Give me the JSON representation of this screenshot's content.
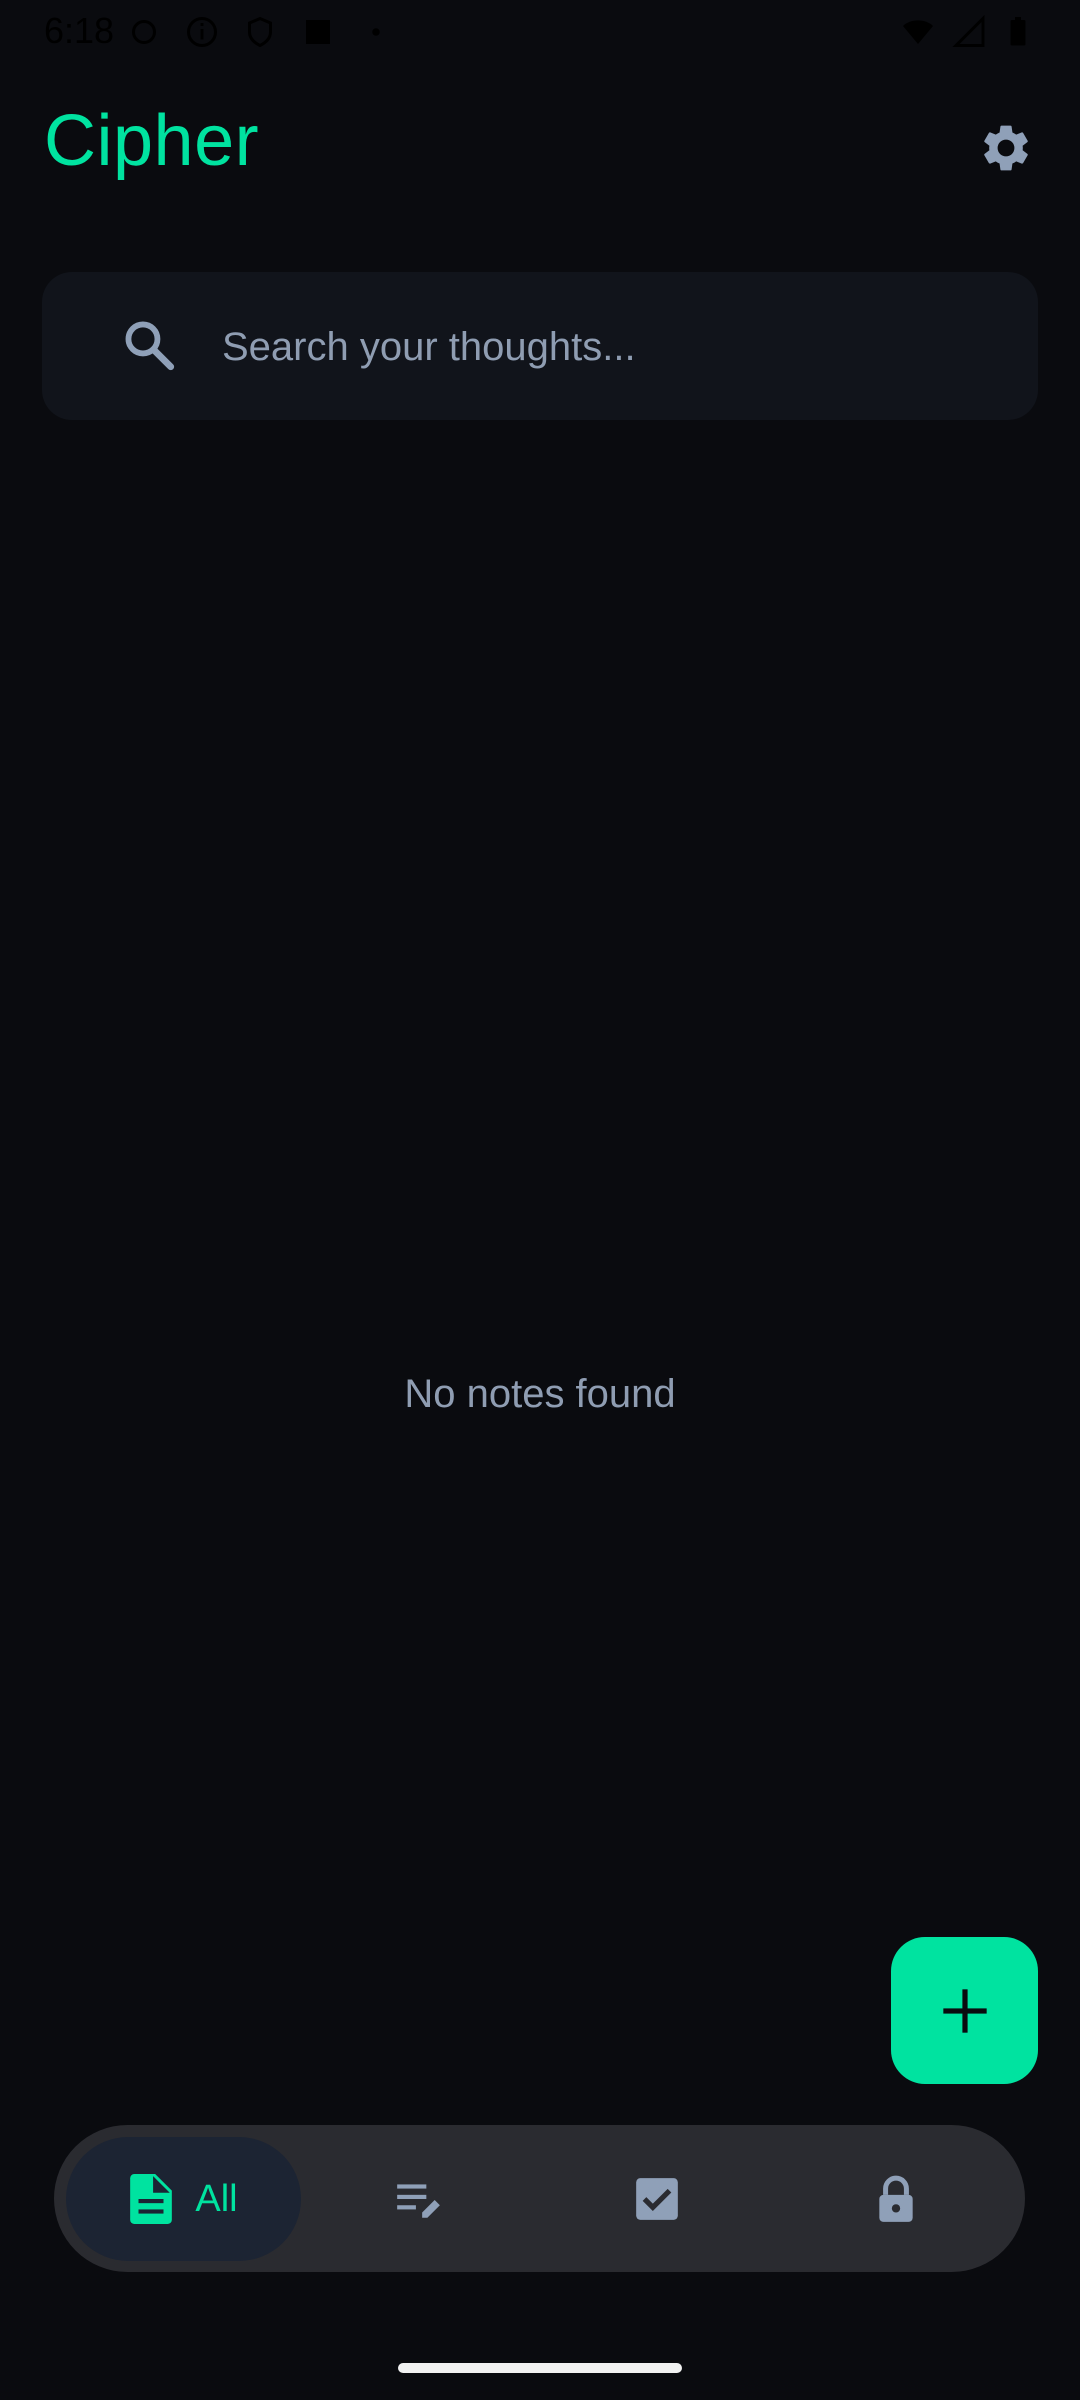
{
  "status_bar": {
    "time": "6:18"
  },
  "header": {
    "title": "Cipher"
  },
  "search": {
    "placeholder": "Search your thoughts..."
  },
  "main": {
    "empty_message": "No notes found"
  },
  "bottom_nav": {
    "items": [
      {
        "label": "All",
        "icon": "document-icon",
        "selected": true
      },
      {
        "label": "",
        "icon": "notes-edit-icon",
        "selected": false
      },
      {
        "label": "",
        "icon": "checkbox-icon",
        "selected": false
      },
      {
        "label": "",
        "icon": "lock-icon",
        "selected": false
      }
    ]
  },
  "colors": {
    "background": "#0a0b0f",
    "accent": "#00e3a0",
    "surface": "#11141b",
    "nav_background": "#2a2b30",
    "nav_selected": "#1c2433",
    "muted_text": "#8f9db2"
  }
}
